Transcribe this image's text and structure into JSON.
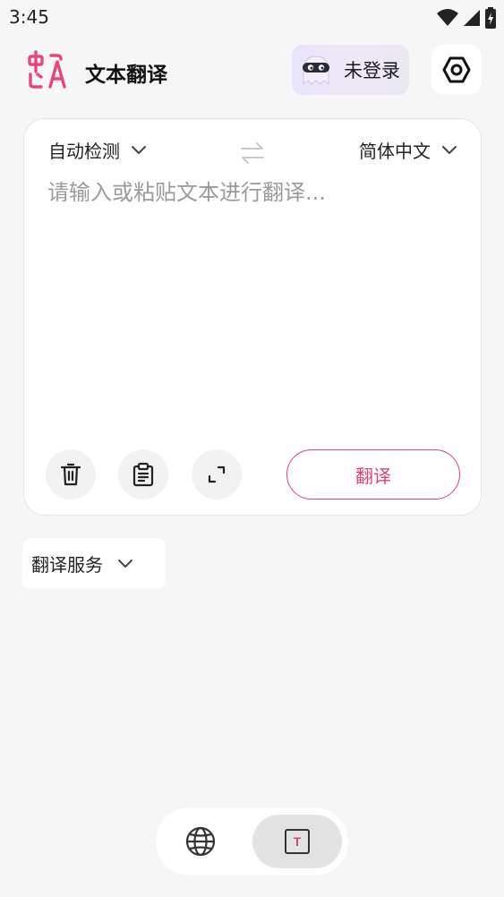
{
  "status_bar": {
    "time": "3:45",
    "icons": [
      "wifi-icon",
      "cellular-signal-icon",
      "battery-charging-icon"
    ]
  },
  "header": {
    "app_title": "文本翻译",
    "login_label": "未登录",
    "icons": [
      "translate-logo-icon",
      "ghost-avatar-icon",
      "settings-icon"
    ]
  },
  "translator": {
    "source_lang": "自动检测",
    "target_lang": "简体中文",
    "input_value": "",
    "input_placeholder": "请输入或粘贴文本进行翻译...",
    "translate_label": "翻译",
    "tools": [
      "delete-icon",
      "paste-icon",
      "expand-icon"
    ]
  },
  "service": {
    "label": "翻译服务"
  },
  "bottom_nav": {
    "items": [
      "web-translate-icon",
      "text-translate-icon"
    ],
    "active": "text-translate-icon"
  },
  "colors": {
    "accent": "#d9456f",
    "background": "#f6f6f6",
    "card": "#ffffff"
  }
}
